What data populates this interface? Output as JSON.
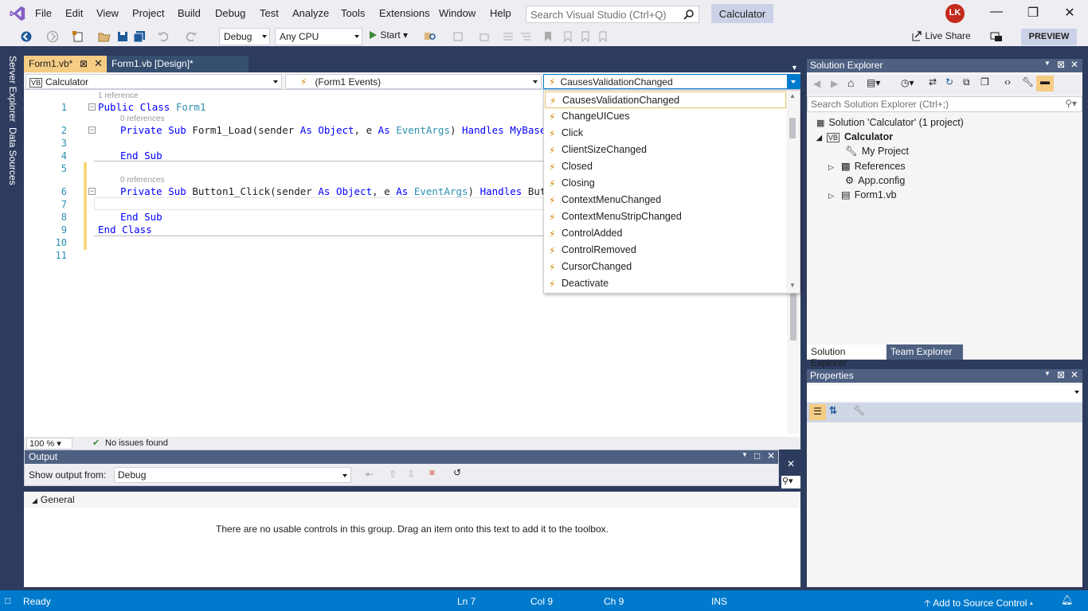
{
  "menubar": {
    "items": [
      "File",
      "Edit",
      "View",
      "Project",
      "Build",
      "Debug",
      "Test",
      "Analyze",
      "Tools",
      "Extensions",
      "Window",
      "Help"
    ],
    "search_placeholder": "Search Visual Studio (Ctrl+Q)",
    "solution_name": "Calculator",
    "avatar_initials": "LK"
  },
  "toolbar": {
    "config": "Debug",
    "platform": "Any CPU",
    "start_label": "Start",
    "liveshare_label": "Live Share",
    "preview_label": "PREVIEW"
  },
  "sidestrip": {
    "server_explorer": "Server Explorer",
    "data_sources": "Data Sources"
  },
  "doctabs": {
    "active": "Form1.vb*",
    "inactive": "Form1.vb [Design]*"
  },
  "editor": {
    "nav_left": "Calculator",
    "nav_middle": "(Form1 Events)",
    "nav_right": "CausesValidationChanged",
    "refs_1": "1 reference",
    "refs_0a": "0 references",
    "refs_0b": "0 references",
    "line_numbers": [
      "1",
      "2",
      "3",
      "4",
      "5",
      "6",
      "7",
      "8",
      "9",
      "10",
      "11"
    ],
    "zoom": "100 %",
    "issues": "No issues found"
  },
  "events": [
    "CausesValidationChanged",
    "ChangeUICues",
    "Click",
    "ClientSizeChanged",
    "Closed",
    "Closing",
    "ContextMenuChanged",
    "ContextMenuStripChanged",
    "ControlAdded",
    "ControlRemoved",
    "CursorChanged",
    "Deactivate"
  ],
  "output": {
    "title": "Output",
    "show_from_label": "Show output from:",
    "show_from_value": "Debug"
  },
  "toolbox": {
    "group": "General",
    "empty_message": "There are no usable controls in this group. Drag an item onto this text to add it to the toolbox."
  },
  "solution_explorer": {
    "title": "Solution Explorer",
    "search_placeholder": "Search Solution Explorer (Ctrl+;)",
    "solution": "Solution 'Calculator' (1 project)",
    "project": "Calculator",
    "items": [
      "My Project",
      "References",
      "App.config",
      "Form1.vb"
    ],
    "tab_solution": "Solution Explorer",
    "tab_team": "Team Explorer"
  },
  "properties": {
    "title": "Properties"
  },
  "statusbar": {
    "ready": "Ready",
    "line": "Ln 7",
    "col": "Col 9",
    "ch": "Ch 9",
    "mode": "INS",
    "source_control": "Add to Source Control"
  },
  "colors": {
    "accent": "#007acc",
    "tab_active": "#f5cc84",
    "panel_title": "#4d6082",
    "frame": "#2d3b5e"
  }
}
